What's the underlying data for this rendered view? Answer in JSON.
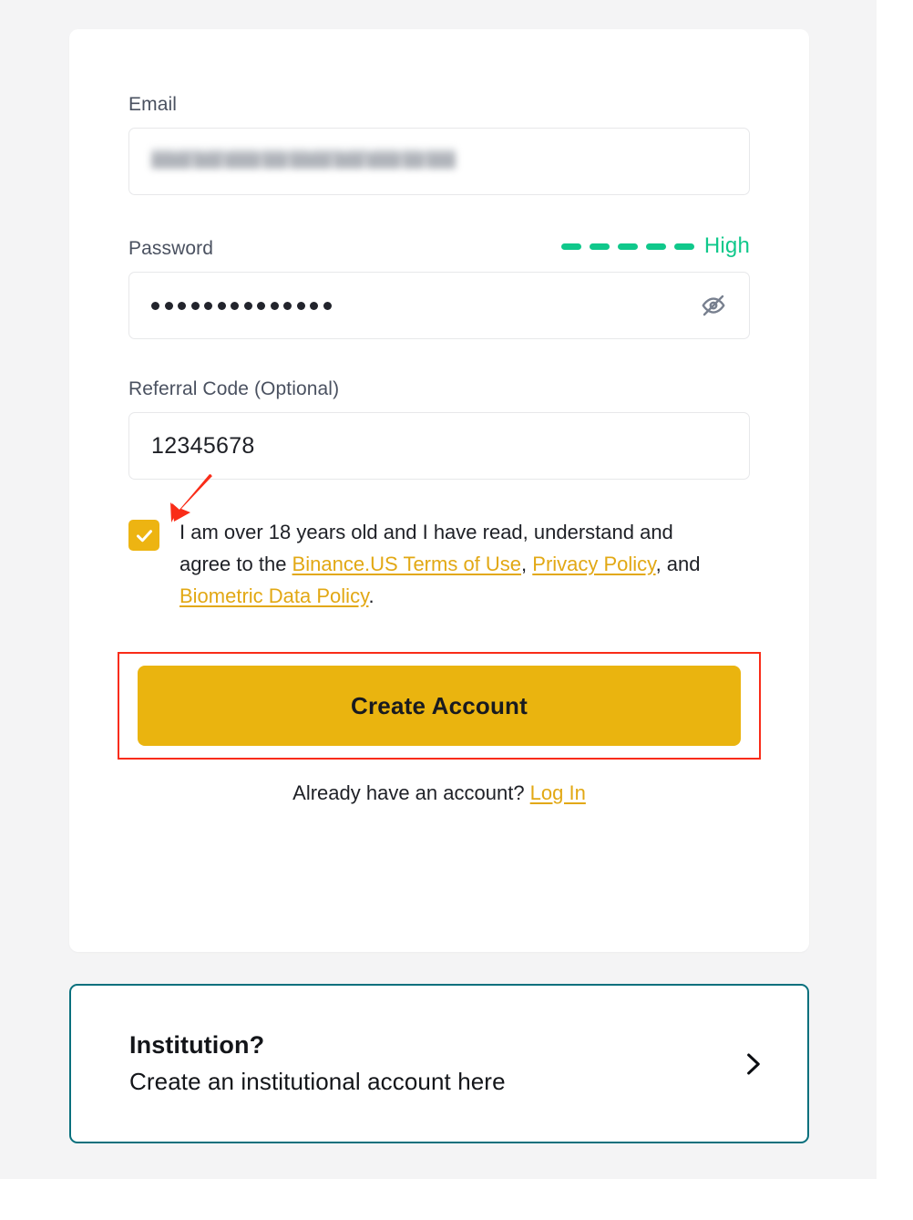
{
  "page": {
    "background_color": "#f4f4f5",
    "card_background": "#ffffff"
  },
  "form": {
    "email": {
      "label": "Email",
      "value": "",
      "redacted": true,
      "placeholder": ""
    },
    "password": {
      "label": "Password",
      "masked_value": "••••••••••••••",
      "dot_count": 14,
      "placeholder": "",
      "strength": {
        "label": "High",
        "filled_segments": 5,
        "total_segments": 5,
        "color": "#10c88b"
      },
      "toggle_icon": "eye-slash-icon"
    },
    "referral": {
      "label": "Referral Code (Optional)",
      "value": "12345678",
      "placeholder": ""
    },
    "terms": {
      "checked": true,
      "checkbox_color": "#edb412",
      "text_part_1": "I am over 18 years old and I have read, understand and agree to the ",
      "link_terms": "Binance.US Terms of Use",
      "separator_1": ", ",
      "link_privacy": "Privacy Policy",
      "separator_2": ", and ",
      "link_biometric": "Biometric Data Policy",
      "text_end": ".",
      "link_color": "#e2a814"
    },
    "submit": {
      "label": "Create Account",
      "background_color": "#eab40f",
      "text_color": "#181a20",
      "highlight_color": "#f92c18"
    },
    "login_prompt": {
      "text": "Already have an account? ",
      "link_label": "Log In"
    }
  },
  "institution": {
    "title": "Institution?",
    "subtitle": "Create an institutional account here",
    "border_color": "#09707d",
    "chevron_icon": "chevron-right-icon"
  },
  "annotations": {
    "arrow_color": "#f92c18",
    "arrow_target": "terms-checkbox",
    "box_target": "create-account-button"
  }
}
